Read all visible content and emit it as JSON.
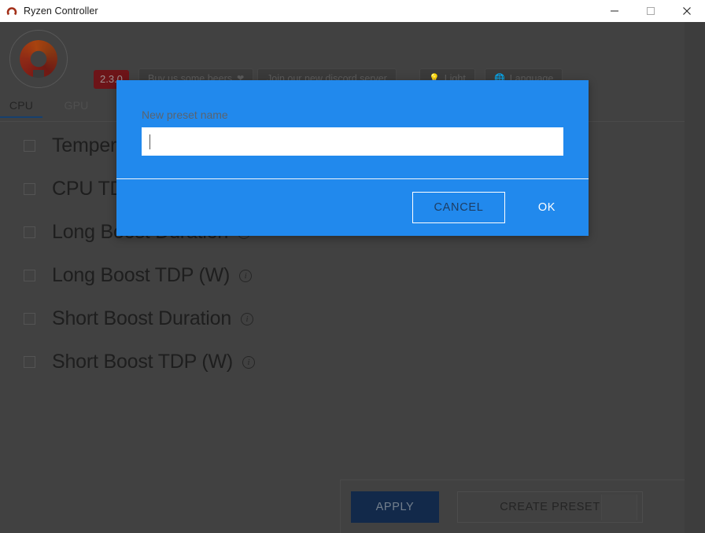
{
  "window": {
    "title": "Ryzen Controller",
    "icon": "ryzen-logo-icon",
    "minimize_label": "—",
    "maximize_label": "□",
    "close_label": "✕"
  },
  "header": {
    "logo_name": "ryzen-controller-logo",
    "version_badge": "2.3.0",
    "buttons": [
      {
        "id": "beers",
        "label": "Buy us some beers",
        "icon": "heart-icon"
      },
      {
        "id": "discord",
        "label": "Join our new discord server",
        "icon": ""
      },
      {
        "id": "theme",
        "label": "Light",
        "icon": "lightbulb-icon"
      },
      {
        "id": "language",
        "label": "Language",
        "icon": "globe-icon"
      }
    ]
  },
  "tabs": [
    {
      "id": "cpu",
      "label": "CPU",
      "active": true
    },
    {
      "id": "gpu",
      "label": "GPU",
      "active": false
    }
  ],
  "settings": {
    "rows": [
      {
        "id": "temperature-limit",
        "label": "Temperature Limit",
        "checked": false,
        "info": true
      },
      {
        "id": "cpu-tdp",
        "label": "CPU TDP (W)",
        "checked": false,
        "info": true
      },
      {
        "id": "long-boost-duration",
        "label": "Long Boost Duration",
        "checked": false,
        "info": true
      },
      {
        "id": "long-boost-tdp",
        "label": "Long Boost TDP (W)",
        "checked": false,
        "info": true
      },
      {
        "id": "short-boost-duration",
        "label": "Short Boost Duration",
        "checked": false,
        "info": true
      },
      {
        "id": "short-boost-tdp",
        "label": "Short Boost TDP (W)",
        "checked": false,
        "info": true
      }
    ]
  },
  "footer": {
    "apply_label": "APPLY",
    "create_preset_label": "CREATE PRESET"
  },
  "dialog": {
    "label": "New preset name",
    "input_value": "",
    "input_placeholder": "",
    "cancel_label": "CANCEL",
    "ok_label": "OK"
  },
  "colors": {
    "dialog_blue": "#2189ed",
    "app_background": "#414141",
    "apply_button": "#12294a",
    "version_badge": "#6d1418",
    "tab_underline": "#16406e"
  }
}
